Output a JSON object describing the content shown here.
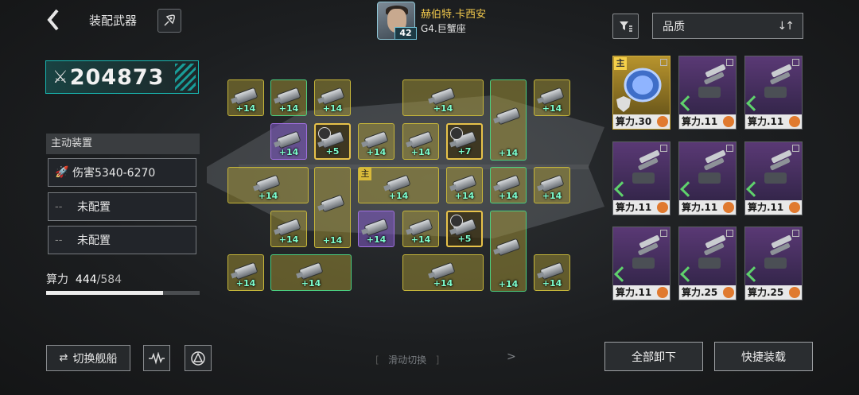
{
  "header": {
    "back_icon": "chevron-left-icon",
    "title": "装配武器",
    "rocket_icon": "rocket-icon"
  },
  "hero": {
    "name": "赫伯特.卡西安",
    "sub": "G4.巨蟹座",
    "level": "42"
  },
  "filter": {
    "icon": "filter-icon"
  },
  "sort": {
    "label": "品质",
    "arrows": "↓↑"
  },
  "power": {
    "icon": "crossed-swords-icon",
    "value": "204873"
  },
  "active_device": {
    "title": "主动装置",
    "slots": [
      {
        "icon": "missile-icon",
        "label": "伤害5340-6270"
      },
      {
        "dash": "--",
        "label": "未配置"
      },
      {
        "dash": "--",
        "label": "未配置"
      }
    ]
  },
  "calc": {
    "label": "算力",
    "used": "444",
    "max": "/584",
    "fill_fraction": 0.76
  },
  "bottom_left": {
    "switch_icon": "swap-icon",
    "switch_label": "切换舰船",
    "wave_icon": "waveform-icon",
    "ship_icon": "triangle-ship-icon"
  },
  "swipe": {
    "left_bracket": "[",
    "label": "滑动切换",
    "right_bracket": "]",
    "arrow": ">"
  },
  "grid": {
    "cells": [
      {
        "lv": "+14",
        "kind": "yellow"
      },
      {
        "lv": "+14",
        "kind": "green"
      },
      {
        "lv": "+14",
        "kind": "yellow"
      },
      {
        "lv": "+14",
        "kind": "yellow"
      },
      {
        "lv": "+14",
        "kind": "green"
      },
      {
        "lv": "+14",
        "kind": "yellow"
      },
      {
        "lv": "+14",
        "kind": "purple"
      },
      {
        "lv": "+5",
        "kind": "core"
      },
      {
        "lv": "+14",
        "kind": "yellow"
      },
      {
        "lv": "+14",
        "kind": "yellow"
      },
      {
        "lv": "+7",
        "kind": "core"
      },
      {
        "lv": "+14",
        "kind": "yellow"
      },
      {
        "lv": "+14",
        "kind": "yellow"
      },
      {
        "lv": "+14",
        "kind": "yellow"
      },
      {
        "lv": "+14",
        "kind": "yellow"
      },
      {
        "lv": "+14",
        "kind": "green"
      },
      {
        "lv": "+14",
        "kind": "yellow"
      },
      {
        "lv": "+14",
        "kind": "yellow"
      },
      {
        "lv": "+14",
        "kind": "purple"
      },
      {
        "lv": "+14",
        "kind": "yellow"
      },
      {
        "lv": "+5",
        "kind": "core"
      },
      {
        "lv": "+14",
        "kind": "green"
      },
      {
        "lv": "+14",
        "kind": "yellow"
      },
      {
        "lv": "+14",
        "kind": "green"
      },
      {
        "lv": "+14",
        "kind": "yellow"
      },
      {
        "lv": "+14",
        "kind": "yellow"
      },
      {
        "lv": "+14",
        "kind": "green"
      }
    ],
    "main_tag": "主"
  },
  "inventory": {
    "main_tag": "主",
    "items": [
      {
        "label": "算力.30",
        "kind": "gold"
      },
      {
        "label": "算力.11",
        "kind": "purple"
      },
      {
        "label": "算力.11",
        "kind": "purple"
      },
      {
        "label": "算力.11",
        "kind": "purple"
      },
      {
        "label": "算力.11",
        "kind": "purple"
      },
      {
        "label": "算力.11",
        "kind": "purple"
      },
      {
        "label": "算力.11",
        "kind": "purple"
      },
      {
        "label": "算力.25",
        "kind": "purple"
      },
      {
        "label": "算力.25",
        "kind": "purple"
      }
    ]
  },
  "actions": {
    "unload_all": "全部卸下",
    "quick_equip": "快捷装载"
  },
  "colors": {
    "accent_teal": "#18b9b3",
    "hero_gold": "#f2c94c",
    "cell_yellow": "#c6b63a",
    "cell_green": "#4bcf80",
    "cell_purple": "#a070e0"
  }
}
